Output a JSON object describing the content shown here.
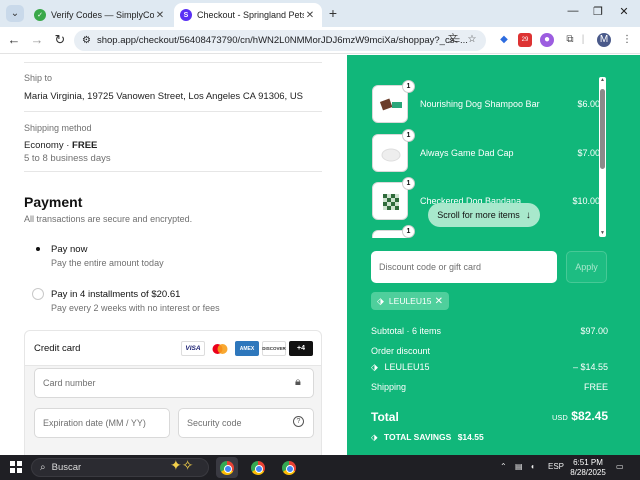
{
  "browser": {
    "tabs": [
      {
        "title": "Verify Codes — SimplyCodes",
        "active": false
      },
      {
        "title": "Checkout - Springland Pets",
        "active": true
      }
    ],
    "url": "shop.app/checkout/56408473790/cn/hWN2L0NMMorJDJ6mzW9mciXa/shoppay?_cs=...",
    "profile_initial": "M"
  },
  "checkout": {
    "ship_to_label": "Ship to",
    "ship_to_value": "Maria Virginia, 19725 Vanowen Street, Los Angeles CA 91306, US",
    "shipping_method_label": "Shipping method",
    "shipping_method_value": "Economy · FREE",
    "shipping_method_value_name": "Economy · ",
    "shipping_method_value_price": "FREE",
    "shipping_method_eta": "5 to 8 business days",
    "payment_title": "Payment",
    "payment_subtitle": "All transactions are secure and encrypted.",
    "options": [
      {
        "title": "Pay now",
        "subtitle": "Pay the entire amount today",
        "selected": true
      },
      {
        "title": "Pay in 4 installments of $20.61",
        "subtitle": "Pay every 2 weeks with no interest or fees",
        "selected": false
      }
    ],
    "credit_card_label": "Credit card",
    "card_brands": [
      "VISA",
      "MC",
      "AMEX",
      "DISCOVER",
      "+4"
    ],
    "card_number_placeholder": "Card number",
    "expiration_placeholder": "Expiration date (MM / YY)",
    "security_placeholder": "Security code"
  },
  "summary": {
    "items": [
      {
        "name": "Nourishing Dog Shampoo Bar",
        "price": "$6.00",
        "qty": "1"
      },
      {
        "name": "Always Game Dad Cap",
        "price": "$7.00",
        "qty": "1"
      },
      {
        "name": "Checkered Dog Bandana",
        "price": "$10.00",
        "qty": "1"
      },
      {
        "name": "",
        "price": "",
        "qty": "1"
      }
    ],
    "scroll_hint": "Scroll for more items",
    "discount_placeholder": "Discount code or gift card",
    "apply_label": "Apply",
    "applied_code": "LEULEU15",
    "subtotal_label": "Subtotal · 6 items",
    "subtotal_value": "$97.00",
    "order_discount_label": "Order discount",
    "discount_code": "LEULEU15",
    "discount_value": "– $14.55",
    "shipping_label": "Shipping",
    "shipping_value": "FREE",
    "total_label": "Total",
    "total_currency": "USD",
    "total_value": "$82.45",
    "savings_label": "TOTAL SAVINGS",
    "savings_value": "$14.55"
  },
  "taskbar": {
    "search_placeholder": "Buscar",
    "lang": "ESP",
    "time": "6:51 PM",
    "date": "8/28/2025"
  }
}
